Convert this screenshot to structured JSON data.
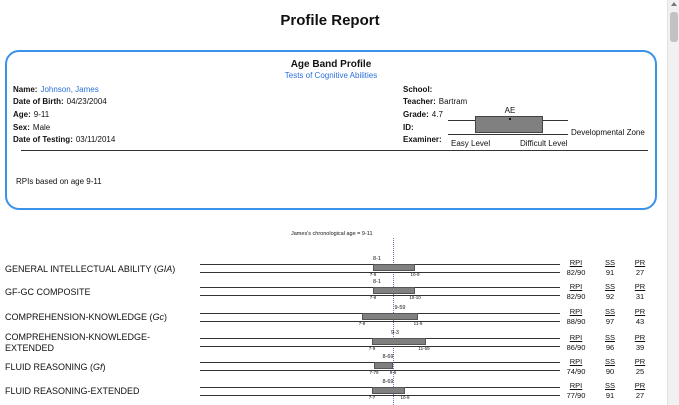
{
  "report_title": "Profile Report",
  "panel": {
    "title": "Age Band Profile",
    "subtitle": "Tests of Cognitive Abilities",
    "left": [
      {
        "label": "Name:",
        "value": "Johnson, James",
        "link": true
      },
      {
        "label": "Date of Birth:",
        "value": "04/23/2004",
        "link": false
      },
      {
        "label": "Age:",
        "value": "9-11",
        "link": false
      },
      {
        "label": "Sex:",
        "value": "Male",
        "link": false
      },
      {
        "label": "Date of Testing:",
        "value": "03/11/2014",
        "link": false
      }
    ],
    "right": [
      {
        "label": "School:",
        "value": ""
      },
      {
        "label": "Teacher:",
        "value": "Bartram"
      },
      {
        "label": "Grade:",
        "value": "4.7"
      },
      {
        "label": "ID:",
        "value": ""
      },
      {
        "label": "Examiner:",
        "value": ""
      }
    ],
    "rpi_note": "RPIs based on age 9-11",
    "legend": {
      "ae": "AE",
      "easy": "Easy Level",
      "difficult": "Difficult Level",
      "zone": "Developmental Zone"
    }
  },
  "chronological_age_label": "James's chronological age = 9-11",
  "score_headers": {
    "rpi": "RPI",
    "ss": "SS",
    "pr": "PR"
  },
  "tests": [
    {
      "name": "GENERAL INTELLECTUAL ABILITY (",
      "abbr": "GIA",
      "suffix": ")",
      "center_age": "8-1",
      "low_age": "7-9",
      "high_age": "10-9",
      "rpi": "82/90",
      "ss": "91",
      "pr": "27"
    },
    {
      "name": "GF-GC COMPOSITE",
      "abbr": "",
      "suffix": "",
      "center_age": "8-1",
      "low_age": "7-9",
      "high_age": "10-10",
      "rpi": "82/90",
      "ss": "92",
      "pr": "31"
    },
    {
      "name": "COMPREHENSION-KNOWLEDGE (",
      "abbr": "Gc",
      "suffix": ")",
      "center_age": "9-59",
      "low_age": "7-9",
      "high_age": "11-9",
      "rpi": "88/90",
      "ss": "97",
      "pr": "43"
    },
    {
      "name": "COMPREHENSION-KNOWLEDGE-",
      "name2": "EXTENDED",
      "abbr": "",
      "suffix": "",
      "center_age": "9-3",
      "low_age": "7-9",
      "high_age": "11-59",
      "rpi": "86/90",
      "ss": "96",
      "pr": "39"
    },
    {
      "name": "FLUID REASONING (",
      "abbr": "Gf",
      "suffix": ")",
      "center_age": "8-69",
      "low_age": "7-79",
      "high_age": "9-9",
      "rpi": "74/90",
      "ss": "90",
      "pr": "25"
    },
    {
      "name": "FLUID REASONING-EXTENDED",
      "abbr": "",
      "suffix": "",
      "center_age": "8-69",
      "low_age": "7-7",
      "high_age": "10-9",
      "rpi": "77/90",
      "ss": "91",
      "pr": "27"
    }
  ]
}
